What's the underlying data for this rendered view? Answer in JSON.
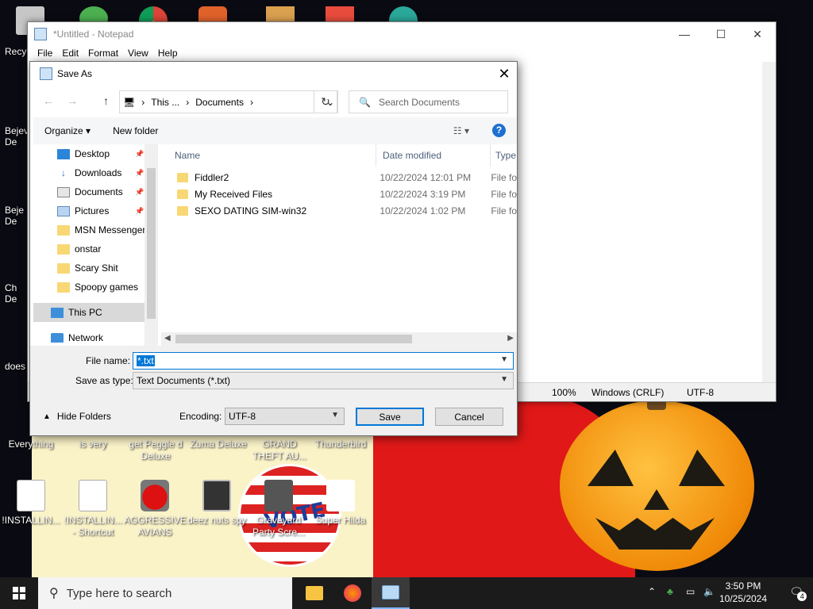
{
  "desktop": {
    "icons": [
      {
        "label": "!INSTALLIN...",
        "glyph": "doc"
      },
      {
        "label": "!INSTALLIN... - Shortcut",
        "glyph": "doc"
      },
      {
        "label": "AGGRESSIVE AVIANS",
        "glyph": "bird"
      },
      {
        "label": "deez nuts spy",
        "glyph": "stack"
      },
      {
        "label": "Graveyard Party Scre...",
        "glyph": "game"
      },
      {
        "label": "Super Hilda",
        "glyph": "ghost"
      }
    ],
    "row_labels": [
      "Everything",
      "is very",
      "get Peggle d Deluxe",
      "Zuma Deluxe",
      "GRAND THEFT AU...",
      "Thunderbird"
    ],
    "left_partial": [
      "Recy",
      "Bejev De",
      "Beje De",
      "Ch De",
      "does"
    ],
    "wallpaper_badge": "VOTE"
  },
  "notepad": {
    "title": "*Untitled - Notepad",
    "controls": {
      "minimize": "—",
      "maximize": "☐",
      "close": "✕"
    },
    "menu": [
      "File",
      "Edit",
      "Format",
      "View",
      "Help"
    ],
    "status": {
      "zoom": "100%",
      "line_endings": "Windows (CRLF)",
      "encoding": "UTF-8"
    }
  },
  "dialog": {
    "title": "Save As",
    "close": "✕",
    "nav": {
      "back": "←",
      "forward": "→",
      "up": "↑",
      "refresh": "↻"
    },
    "address": {
      "segments": [
        "This ...",
        "Documents"
      ],
      "separator": "›",
      "dropdown": "⌄"
    },
    "search": {
      "placeholder": "Search Documents",
      "icon": "🔍"
    },
    "toolbar": {
      "organize": "Organize ▾",
      "new_folder": "New folder",
      "view": "☷ ▾",
      "help": "?"
    },
    "nav_pane": [
      {
        "label": "Desktop",
        "icon": "desk",
        "pinned": true
      },
      {
        "label": "Downloads",
        "icon": "down",
        "pinned": true
      },
      {
        "label": "Documents",
        "icon": "docs",
        "pinned": true
      },
      {
        "label": "Pictures",
        "icon": "pics",
        "pinned": true
      },
      {
        "label": "MSN Messenger",
        "icon": "folder",
        "pinned": false
      },
      {
        "label": "onstar",
        "icon": "folder",
        "pinned": false
      },
      {
        "label": "Scary Shit",
        "icon": "folder",
        "pinned": false
      },
      {
        "label": "Spoopy games",
        "icon": "folder",
        "pinned": false
      },
      {
        "label": "",
        "icon": "none",
        "pinned": false
      },
      {
        "label": "This PC",
        "icon": "pc",
        "pinned": false,
        "selected": true
      },
      {
        "label": "",
        "icon": "none",
        "pinned": false
      },
      {
        "label": "Network",
        "icon": "net",
        "pinned": false
      }
    ],
    "columns": {
      "name": "Name",
      "date": "Date modified",
      "type": "Type"
    },
    "files": [
      {
        "name": "Fiddler2",
        "date": "10/22/2024 12:01 PM",
        "type": "File fo"
      },
      {
        "name": "My Received Files",
        "date": "10/22/2024 3:19 PM",
        "type": "File fo"
      },
      {
        "name": "SEXO DATING SIM-win32",
        "date": "10/22/2024 1:02 PM",
        "type": "File fo"
      }
    ],
    "file_name_label": "File name:",
    "file_name_value": "*.txt",
    "save_type_label": "Save as type:",
    "save_type_value": "Text Documents (*.txt)",
    "hide_folders": "Hide Folders",
    "encoding_label": "Encoding:",
    "encoding_value": "UTF-8",
    "save_button": "Save",
    "cancel_button": "Cancel"
  },
  "taskbar": {
    "search_placeholder": "Type here to search",
    "time": "3:50 PM",
    "date": "10/25/2024",
    "notification_count": "4"
  }
}
